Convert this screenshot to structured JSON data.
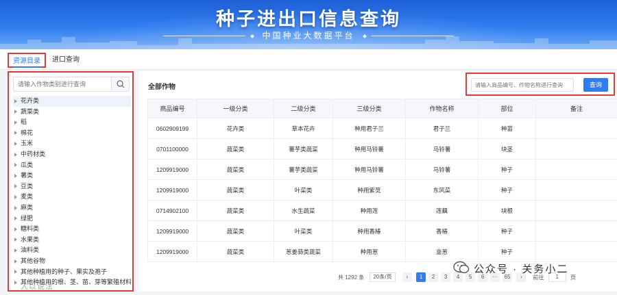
{
  "banner": {
    "title": "种子进出口信息查询",
    "subtitle": "中国种业大数据平台"
  },
  "tabs": [
    {
      "label": "资源目录"
    },
    {
      "label": "进口查询"
    }
  ],
  "left": {
    "search_placeholder": "请输入作物类别进行查询",
    "tree": [
      "花卉类",
      "蔬菜类",
      "稻",
      "棉花",
      "玉米",
      "中药材类",
      "瓜类",
      "薯类",
      "豆类",
      "麦类",
      "麻类",
      "绿肥",
      "糖料类",
      "水果类",
      "油料类",
      "其他谷物",
      "其他种植用的种子、果实及孢子",
      "其他种植用的根、茎、苗、芽等繁殖材料"
    ]
  },
  "main": {
    "section_title": "全部作物",
    "query_placeholder": "请输入商品编号、作物名称进行查询",
    "query_button": "查询",
    "columns": [
      "商品编号",
      "一级分类",
      "二级分类",
      "三级分类",
      "作物名称",
      "部位",
      "备注"
    ],
    "rows": [
      [
        "0602909199",
        "花卉类",
        "草本花卉",
        "种用君子兰",
        "君子兰",
        "种苗",
        ""
      ],
      [
        "0701100000",
        "蔬菜类",
        "薯芋类蔬菜",
        "种用马铃薯",
        "马铃薯",
        "块茎",
        ""
      ],
      [
        "1209919000",
        "蔬菜类",
        "薯芋类蔬菜",
        "种用马铃薯",
        "马铃薯",
        "种子",
        ""
      ],
      [
        "1209919000",
        "蔬菜类",
        "叶菜类",
        "种用紫苋",
        "东风菜",
        "种子",
        ""
      ],
      [
        "0714902100",
        "蔬菜类",
        "水生蔬菜",
        "种用莲",
        "莲藕",
        "块根",
        ""
      ],
      [
        "1209919000",
        "蔬菜类",
        "叶菜类",
        "种用香椿",
        "香椿",
        "种子",
        ""
      ],
      [
        "1209919000",
        "蔬菜类",
        "葱姜蒜类蔬菜",
        "种用葱",
        "韭葱",
        "种子",
        ""
      ]
    ],
    "pager": {
      "total": "共 1292 条",
      "page_size": "20条/页",
      "prev": "‹",
      "pages": [
        "1",
        "2",
        "3",
        "4",
        "5",
        "6",
        "···",
        "65"
      ],
      "next": "›",
      "goto": "前往",
      "goto_value": "1",
      "page_unit": "页"
    }
  },
  "watermark": {
    "text": "公众号 · 关务小二",
    "overlay_text": "人以说法"
  }
}
